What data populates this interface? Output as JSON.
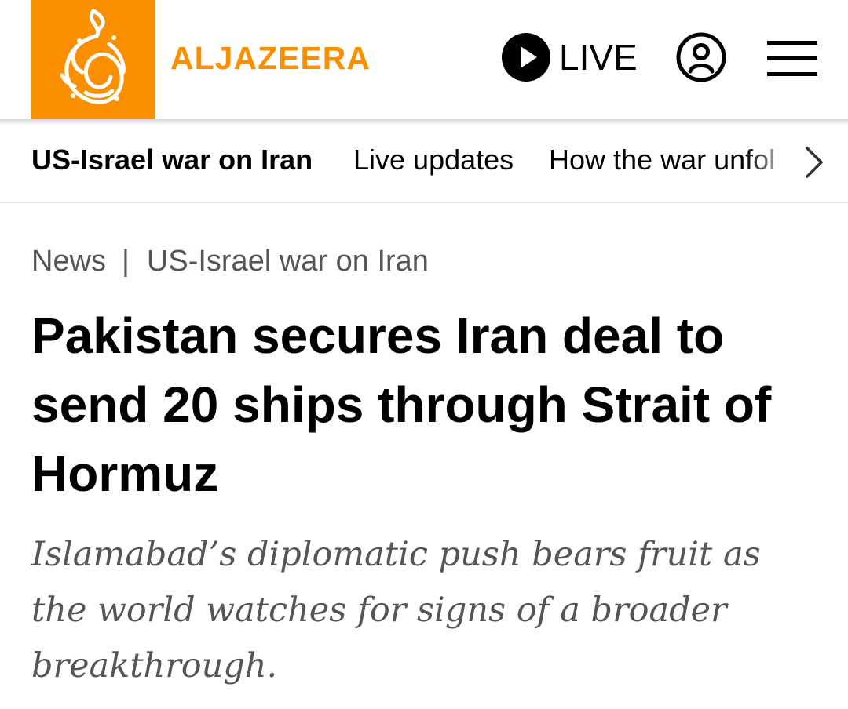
{
  "header": {
    "brand": "ALJAZEERA",
    "live_label": "LIVE",
    "colors": {
      "brand_orange": "#fa9000"
    },
    "icons": {
      "logo": "aljazeera-calligraphy-logo",
      "live": "play-circle-icon",
      "account": "user-icon",
      "menu": "hamburger-menu-icon"
    }
  },
  "subnav": {
    "items": [
      {
        "label": "US-Israel war on Iran",
        "active": true
      },
      {
        "label": "Live updates"
      },
      {
        "label": "How the war unfol"
      }
    ],
    "next_icon": "chevron-right-icon"
  },
  "article": {
    "breadcrumb": {
      "section": "News",
      "separator": "|",
      "topic": "US-Israel war on Iran"
    },
    "headline": "Pakistan secures Iran deal to send 20 ships through Strait of Hormuz",
    "dek": "Islamabad’s diplomatic push bears fruit as the world watches for signs of a broader breakthrough."
  }
}
